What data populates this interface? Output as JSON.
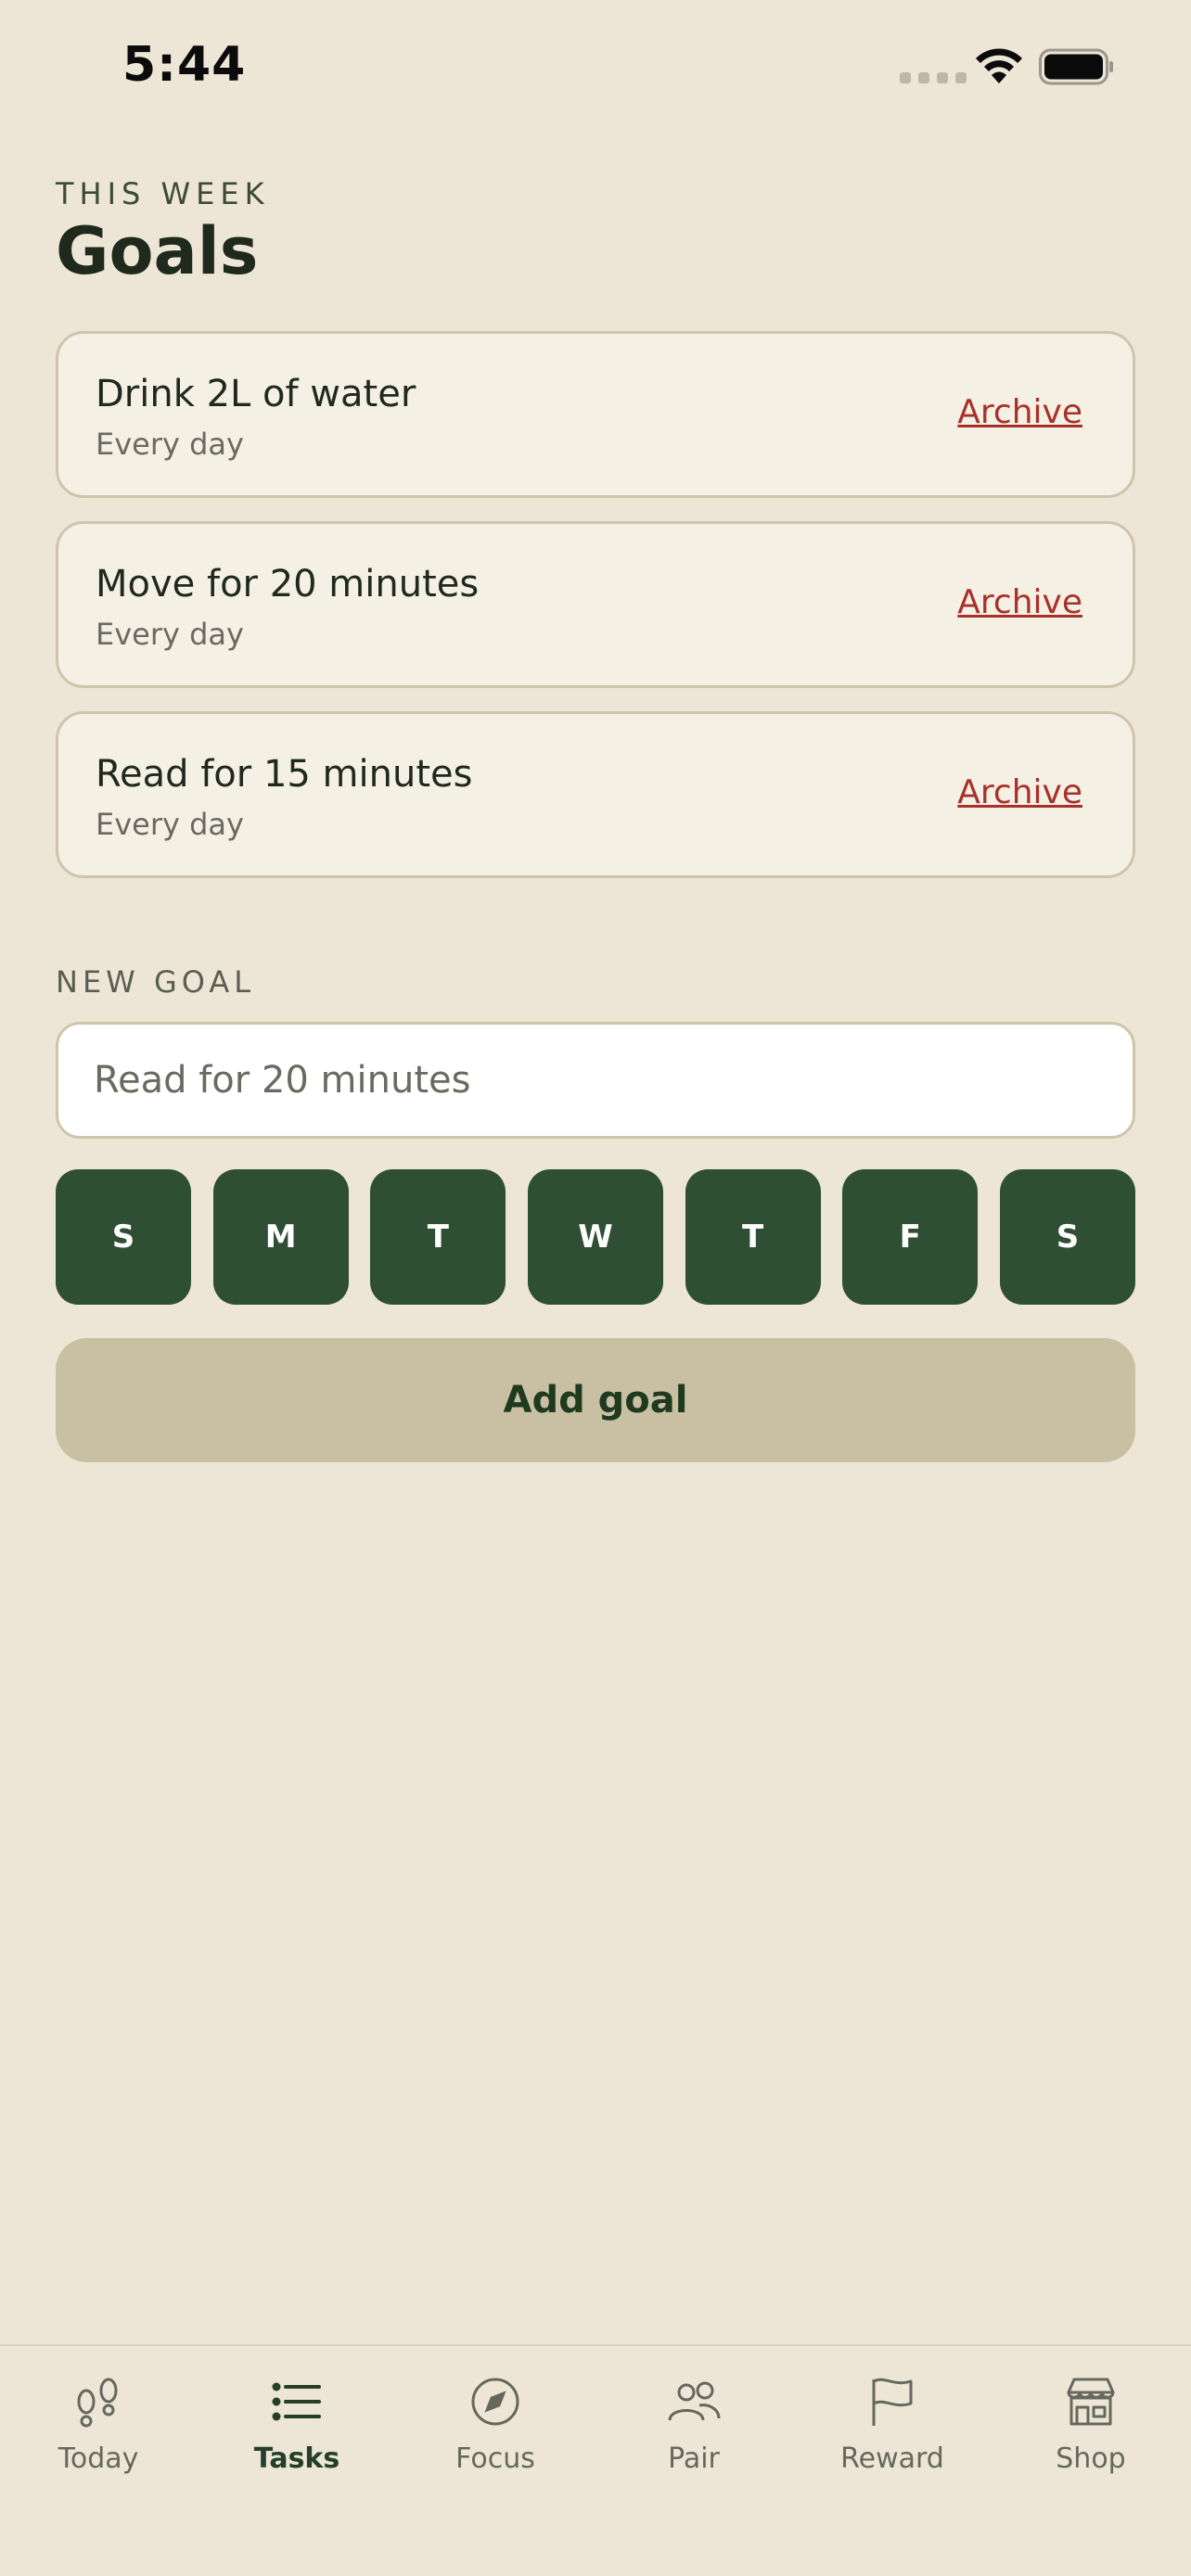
{
  "status_bar": {
    "time": "5:44"
  },
  "header": {
    "eyebrow": "THIS WEEK",
    "title": "Goals"
  },
  "goals": [
    {
      "title": "Drink 2L of water",
      "frequency": "Every day",
      "action": "Archive"
    },
    {
      "title": "Move for 20 minutes",
      "frequency": "Every day",
      "action": "Archive"
    },
    {
      "title": "Read for 15 minutes",
      "frequency": "Every day",
      "action": "Archive"
    }
  ],
  "new_goal": {
    "label": "NEW GOAL",
    "placeholder": "Read for 20 minutes",
    "days": [
      "S",
      "M",
      "T",
      "W",
      "T",
      "F",
      "S"
    ],
    "submit_label": "Add goal"
  },
  "tabs": [
    {
      "label": "Today",
      "icon": "footprints-icon"
    },
    {
      "label": "Tasks",
      "icon": "list-icon",
      "active": true
    },
    {
      "label": "Focus",
      "icon": "compass-icon"
    },
    {
      "label": "Pair",
      "icon": "people-icon"
    },
    {
      "label": "Reward",
      "icon": "flag-icon"
    },
    {
      "label": "Shop",
      "icon": "storefront-icon"
    }
  ],
  "colors": {
    "background": "#ede6d7",
    "card": "#f5f0e4",
    "accent_green": "#2e4f33",
    "archive_red": "#a8322b",
    "button_tan": "#c9c0a4"
  }
}
